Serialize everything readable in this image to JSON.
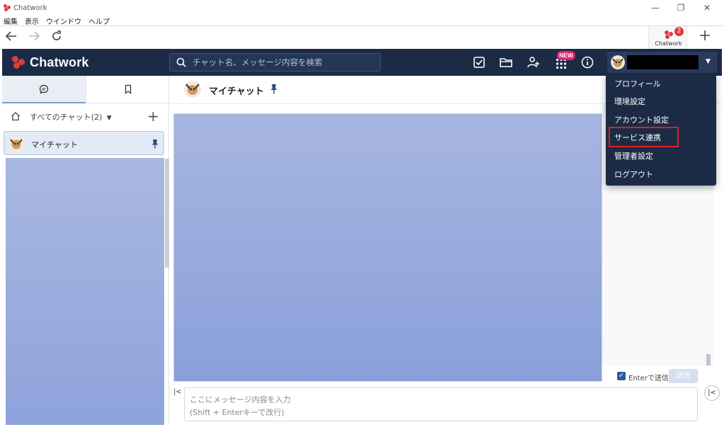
{
  "window": {
    "title": "Chatwork",
    "controls": {
      "minimize": "—",
      "restore": "❐",
      "close": "✕"
    }
  },
  "menubar": [
    "編集",
    "表示",
    "ウインドウ",
    "ヘルプ"
  ],
  "browser": {
    "tab_label": "Chatwork",
    "tab_badge": "2",
    "icons": [
      "back-arrow-icon",
      "forward-arrow-icon",
      "reload-icon",
      "plus-icon"
    ]
  },
  "header": {
    "brand": "Chatwork",
    "search_placeholder": "チャット名、メッセージ内容を検索",
    "new_badge": "NEW",
    "icons": [
      "task-check-icon",
      "folder-icon",
      "contact-add-icon",
      "apps-grid-icon",
      "info-icon"
    ]
  },
  "sidebar": {
    "filter_label": "すべてのチャット(2)",
    "filter_caret": "▼",
    "add_symbol": "+",
    "rooms": [
      {
        "name": "マイチャット",
        "pinned": true
      }
    ]
  },
  "chat": {
    "title": "マイチャット",
    "enter_to_send_label": "Enterで送信",
    "enter_to_send_checked": true,
    "send_label": "送信",
    "input_placeholder_line1": "ここにメッセージ内容を入力",
    "input_placeholder_line2": "(Shift + Enterキーで改行)"
  },
  "user_menu": {
    "caret": "▼",
    "items": [
      {
        "label": "プロフィール"
      },
      {
        "label": "環境設定"
      },
      {
        "label": "アカウント設定"
      },
      {
        "label": "サービス連携",
        "highlighted": true
      },
      {
        "label": "管理者設定"
      },
      {
        "label": "ログアウト"
      }
    ]
  },
  "colors": {
    "header_bg": "#1c2b45",
    "brand_red": "#e0393e",
    "highlight_box": "#e01f1f",
    "new_badge": "#e0266f"
  }
}
